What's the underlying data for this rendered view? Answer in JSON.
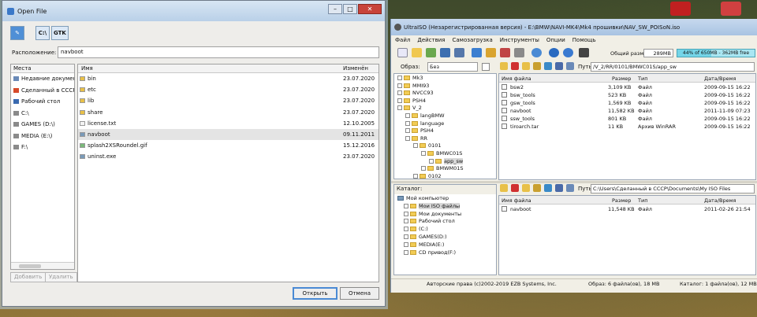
{
  "open_dialog": {
    "title": "Open File",
    "toolbar": {
      "edit_icon": "pencil-icon",
      "path_btn_1": "C:\\",
      "path_btn_2": "GTK"
    },
    "location_label": "Расположение:",
    "location_value": "navboot",
    "places_header": "Места",
    "places": [
      {
        "label": "Недавние документ",
        "icon": "recent-icon"
      },
      {
        "label": "Сделанный в СССР",
        "icon": "home-folder-icon"
      },
      {
        "label": "Рабочий стол",
        "icon": "desktop-icon"
      },
      {
        "label": "C:\\",
        "icon": "drive-icon"
      },
      {
        "label": "GAMES (D:\\)",
        "icon": "drive-icon"
      },
      {
        "label": "MEDIA (E:\\)",
        "icon": "drive-icon"
      },
      {
        "label": "F:\\",
        "icon": "drive-icon"
      }
    ],
    "add_button": "Добавить",
    "remove_button": "Удалить",
    "col_name": "Имя",
    "col_modified": "Изменён",
    "files": [
      {
        "name": "bin",
        "date": "23.07.2020",
        "type": "folder"
      },
      {
        "name": "etc",
        "date": "23.07.2020",
        "type": "folder"
      },
      {
        "name": "lib",
        "date": "23.07.2020",
        "type": "folder"
      },
      {
        "name": "share",
        "date": "23.07.2020",
        "type": "folder"
      },
      {
        "name": "license.txt",
        "date": "12.10.2005",
        "type": "file"
      },
      {
        "name": "navboot",
        "date": "09.11.2011",
        "type": "exe",
        "selected": true
      },
      {
        "name": "splash2XSRoundel.gif",
        "date": "15.12.2016",
        "type": "image"
      },
      {
        "name": "uninst.exe",
        "date": "23.07.2020",
        "type": "exe"
      }
    ],
    "open_button": "Открыть",
    "cancel_button": "Отмена"
  },
  "ultraiso": {
    "title": "UltraISO (Незарегистрированная версия) - E:\\BMW\\NAVI-MK4\\Mk4 прошивки\\NAV_SW_POISoN.iso",
    "menu": [
      "Файл",
      "Действия",
      "Самозагрузка",
      "Инструменты",
      "Опции",
      "Помощь"
    ],
    "total_label": "Общий размер:",
    "total_value": "289MB",
    "gauge_text": "44% of 650MB - 362MB free",
    "gauge_fraction": 0.44,
    "image_label": "Образ:",
    "image_value": "Без самозагрузки",
    "path_label": "Путь:",
    "iso_path": "/V_2/RR/0101/BMWC01S/app_sw",
    "tree": [
      {
        "label": "Mk3",
        "level": 1
      },
      {
        "label": "MMI93",
        "level": 1
      },
      {
        "label": "NVCC93",
        "level": 1
      },
      {
        "label": "PSH4",
        "level": 1
      },
      {
        "label": "V_2",
        "level": 1
      },
      {
        "label": "langBMW",
        "level": 2
      },
      {
        "label": "language",
        "level": 2
      },
      {
        "label": "PSH4",
        "level": 2
      },
      {
        "label": "RR",
        "level": 2
      },
      {
        "label": "0101",
        "level": 3
      },
      {
        "label": "BMWC01S",
        "level": 4
      },
      {
        "label": "app_sw",
        "level": 5,
        "selected": true
      },
      {
        "label": "BMWM01S",
        "level": 4
      },
      {
        "label": "0102",
        "level": 3
      }
    ],
    "columns": [
      "Имя файла",
      "Размер",
      "Тип",
      "Дата/Время"
    ],
    "iso_files": [
      {
        "name": "bsw2",
        "size": "3,109 KB",
        "type": "Файл",
        "date": "2009-09-15 16:22"
      },
      {
        "name": "bsw_tools",
        "size": "523 KB",
        "type": "Файл",
        "date": "2009-09-15 16:22"
      },
      {
        "name": "gsw_tools",
        "size": "1,569 KB",
        "type": "Файл",
        "date": "2009-09-15 16:22"
      },
      {
        "name": "navboot",
        "size": "11,582 KB",
        "type": "Файл",
        "date": "2011-11-09 07:23"
      },
      {
        "name": "ssw_tools",
        "size": "801 KB",
        "type": "Файл",
        "date": "2009-09-15 16:22"
      },
      {
        "name": "tiroarch.tar",
        "size": "11 KB",
        "type": "Архив WinRAR",
        "date": "2009-09-15 16:22"
      }
    ],
    "catalog_label": "Каталог:",
    "local_path": "C:\\Users\\Сделанный в СССР\\Documents\\My ISO Files",
    "catalog": [
      {
        "label": "Мой компьютер",
        "level": 0
      },
      {
        "label": "Мои ISO файлы",
        "level": 1,
        "selected": true
      },
      {
        "label": "Мои документы",
        "level": 1
      },
      {
        "label": "Рабочий стол",
        "level": 1
      },
      {
        "label": "(C:)",
        "level": 1
      },
      {
        "label": "GAMES(D:)",
        "level": 1
      },
      {
        "label": "MEDIA(E:)",
        "level": 1
      },
      {
        "label": "CD привод(F:)",
        "level": 1
      }
    ],
    "local_files": [
      {
        "name": "navboot",
        "size": "11,548 KB",
        "type": "Файл",
        "date": "2011-02-26 21:54"
      }
    ],
    "status_copyright": "Авторские права (c)2002-2019 EZB Systems, Inc.",
    "status_image": "Образ: 6 файла(ов), 18 MB",
    "status_catalog": "Каталог: 1 файла(ов), 12 MB"
  }
}
